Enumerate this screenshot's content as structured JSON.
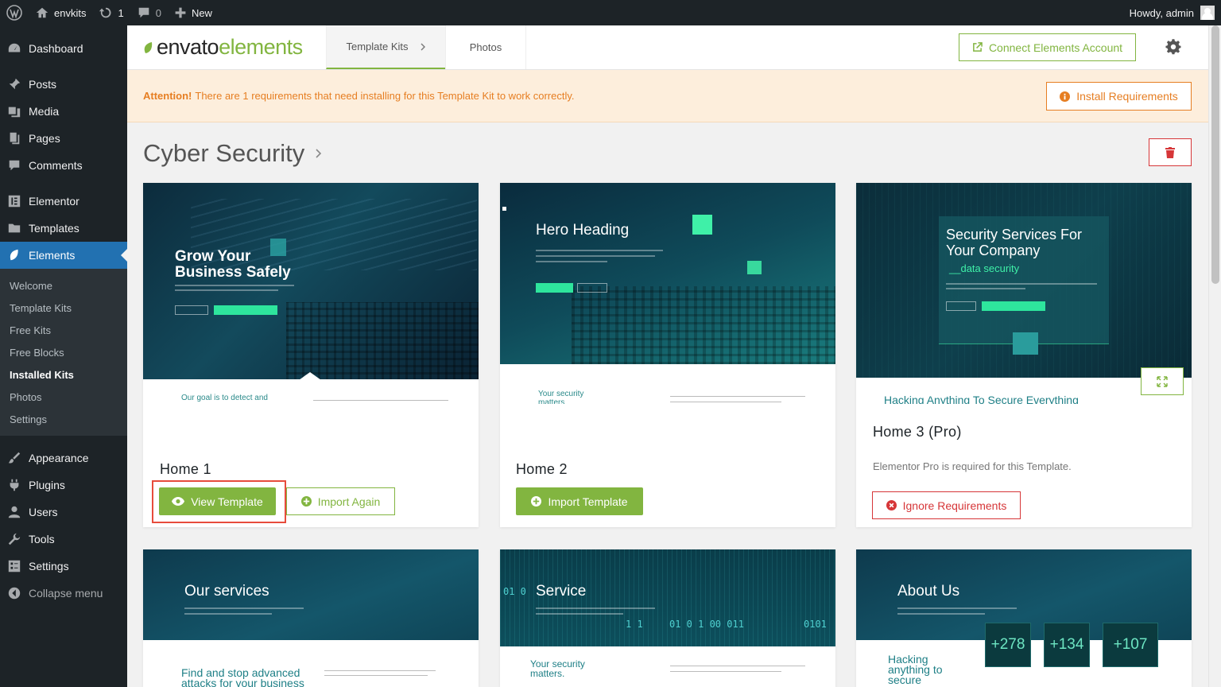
{
  "adminbar": {
    "site_name": "envkits",
    "updates_count": "1",
    "comments_count": "0",
    "new_label": "New",
    "howdy": "Howdy, admin"
  },
  "sidebar": {
    "items": [
      {
        "label": "Dashboard",
        "icon": "dashboard-icon"
      },
      {
        "label": "Posts",
        "icon": "pin-icon"
      },
      {
        "label": "Media",
        "icon": "media-icon"
      },
      {
        "label": "Pages",
        "icon": "pages-icon"
      },
      {
        "label": "Comments",
        "icon": "comments-icon"
      },
      {
        "label": "Elementor",
        "icon": "elementor-icon"
      },
      {
        "label": "Templates",
        "icon": "folder-icon"
      },
      {
        "label": "Elements",
        "icon": "leaf-icon"
      }
    ],
    "submenu": [
      "Welcome",
      "Template Kits",
      "Free Kits",
      "Free Blocks",
      "Installed Kits",
      "Photos",
      "Settings"
    ],
    "bottom_items": [
      {
        "label": "Appearance",
        "icon": "brush-icon"
      },
      {
        "label": "Plugins",
        "icon": "plug-icon"
      },
      {
        "label": "Users",
        "icon": "users-icon"
      },
      {
        "label": "Tools",
        "icon": "wrench-icon"
      },
      {
        "label": "Settings",
        "icon": "settings-icon"
      },
      {
        "label": "Collapse menu",
        "icon": "collapse-icon"
      }
    ]
  },
  "header": {
    "logo_part1": "envato",
    "logo_part2": "elements",
    "tab_template_kits": "Template Kits",
    "tab_photos": "Photos",
    "connect_label": "Connect Elements Account"
  },
  "attention": {
    "strong": "Attention!",
    "message": "There are 1 requirements that need installing for this Template Kit to work correctly.",
    "install_label": "Install Requirements"
  },
  "kit": {
    "title": "Cyber Security"
  },
  "cards": [
    {
      "name": "Home 1",
      "thumb_title_1": "Grow Your",
      "thumb_title_2": "Business Safely",
      "thumb_sub": "Our goal is to detect and",
      "btn_primary": "View Template",
      "btn_secondary": "Import Again"
    },
    {
      "name": "Home 2",
      "thumb_title_1": "Hero Heading",
      "thumb_sub_1": "Your security",
      "thumb_sub_2": "matters",
      "btn_primary": "Import Template"
    },
    {
      "name": "Home 3 (Pro)",
      "thumb_title_1": "Security Services For",
      "thumb_title_2": "Your Company",
      "thumb_tag": "__data security",
      "thumb_sub": "Hacking Anything To Secure Everything",
      "note": "Elementor Pro is required for this Template.",
      "btn_ignore": "Ignore Requirements"
    },
    {
      "thumb_title_1": "Our services",
      "thumb_sub_1": "Find and stop advanced",
      "thumb_sub_2": "attacks for your business"
    },
    {
      "thumb_title_1": "Service",
      "thumb_sub_1": "Your security",
      "thumb_sub_2": "matters."
    },
    {
      "thumb_title_1": "About Us",
      "thumb_sub_1": "Hacking",
      "thumb_sub_2": "anything to",
      "thumb_sub_3": "secure",
      "stats": [
        "+278",
        "+134",
        "+107"
      ]
    }
  ],
  "colors": {
    "accent_green": "#82b540",
    "wp_blue": "#2271b1",
    "warning_orange": "#e67e22",
    "danger_red": "#d63638"
  }
}
